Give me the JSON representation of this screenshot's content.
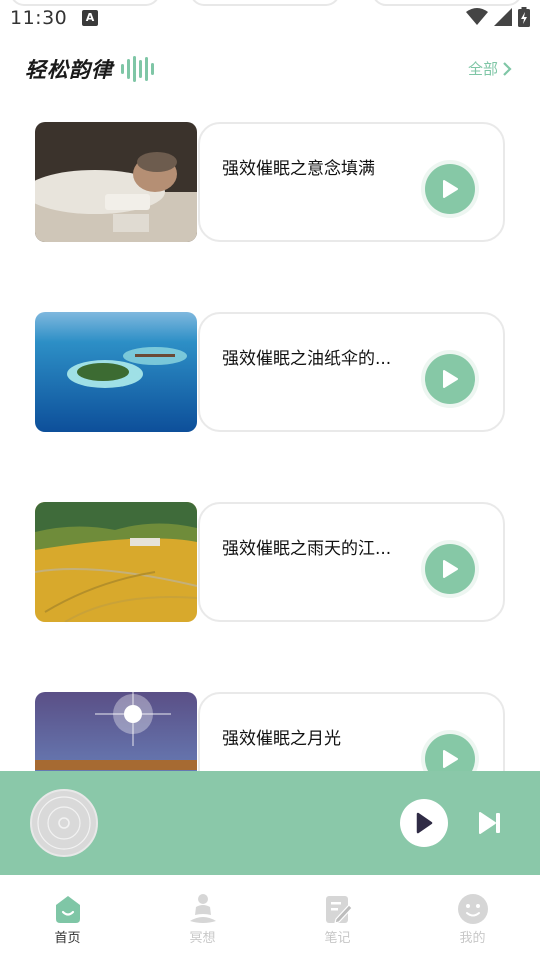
{
  "status_bar": {
    "time": "11:30",
    "notification_icon": "A",
    "icons": [
      "wifi-icon",
      "signal-icon",
      "battery-charging-icon"
    ]
  },
  "header": {
    "brand": "轻松韵律",
    "see_all": "全部"
  },
  "tracks": [
    {
      "title": "强效催眠之意念填满",
      "image": "man-sleeping-photo"
    },
    {
      "title": "强效催眠之油纸伞的...",
      "image": "tropical-island-photo"
    },
    {
      "title": "强效催眠之雨天的江...",
      "image": "terraced-rice-fields-photo"
    },
    {
      "title": "强效催眠之月光",
      "image": "sunlit-road-photo"
    }
  ],
  "player": {
    "play_icon": "play-icon",
    "next_icon": "skip-next-icon"
  },
  "nav": {
    "items": [
      {
        "label": "首页",
        "icon": "home-icon",
        "active": true
      },
      {
        "label": "冥想",
        "icon": "meditation-icon",
        "active": false
      },
      {
        "label": "笔记",
        "icon": "note-icon",
        "active": false
      },
      {
        "label": "我的",
        "icon": "profile-icon",
        "active": false
      }
    ]
  },
  "colors": {
    "accent": "#86c8a6",
    "player_bg": "#8ac8a9",
    "inactive": "#c8c8c8"
  }
}
